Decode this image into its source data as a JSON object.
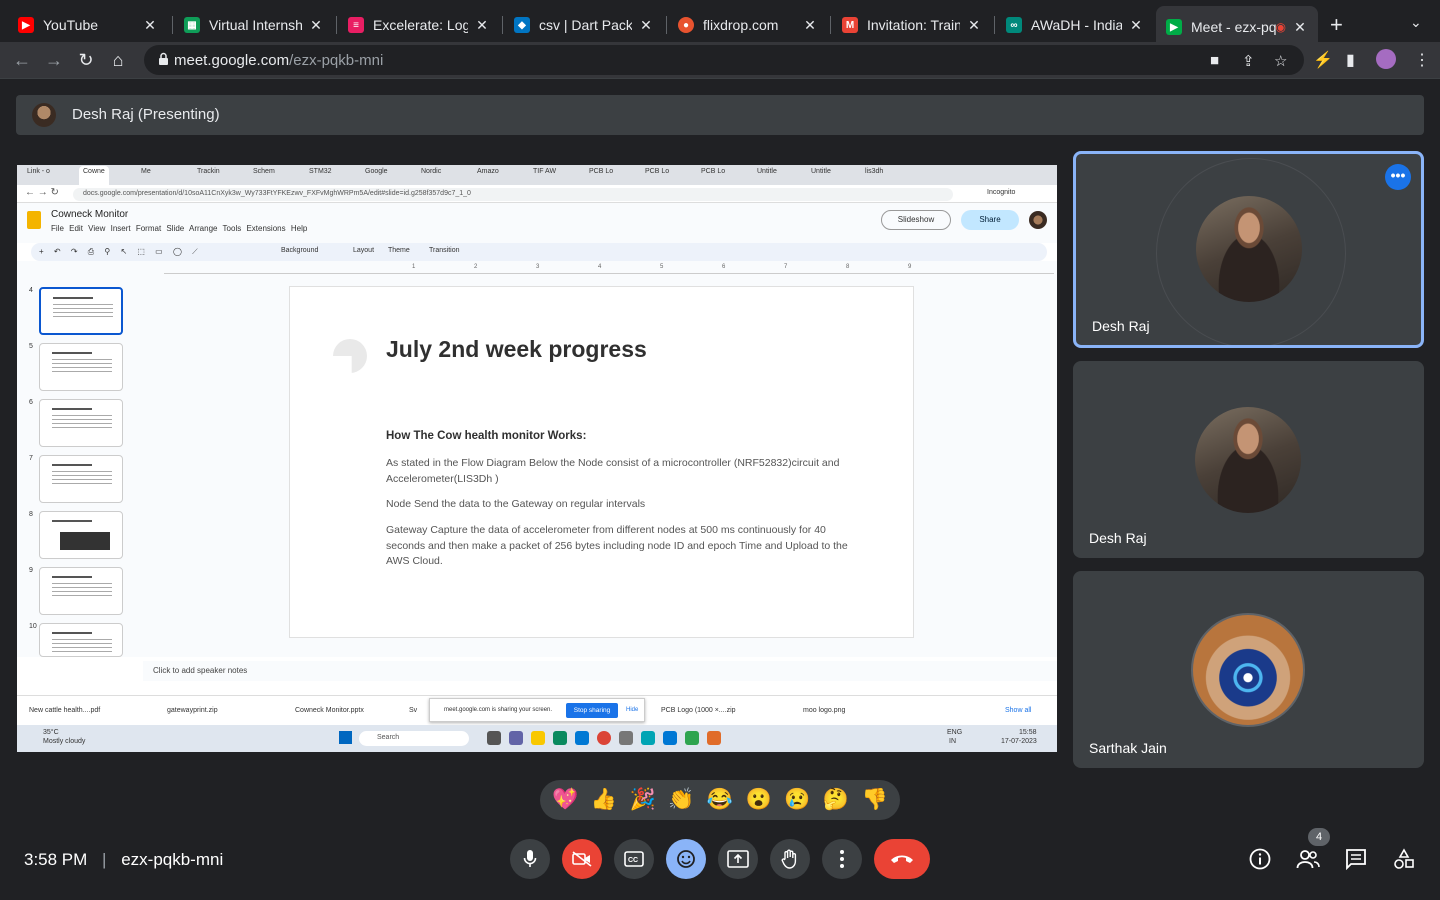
{
  "browser": {
    "tabs": [
      {
        "title": "YouTube",
        "icon": "youtube-icon",
        "color": "#ff0000"
      },
      {
        "title": "Virtual Internship",
        "icon": "google-sheets-icon",
        "color": "#0f9d58"
      },
      {
        "title": "Excelerate: Log in",
        "icon": "excelerate-icon",
        "color": "#e91e63"
      },
      {
        "title": "csv | Dart Package",
        "icon": "dart-icon",
        "color": "#0175c2"
      },
      {
        "title": "flixdrop.com",
        "icon": "flixdrop-icon",
        "color": "#e8532f"
      },
      {
        "title": "Invitation: Training",
        "icon": "gmail-icon",
        "color": "#ea4335"
      },
      {
        "title": "AWaDH - Indian In",
        "icon": "awadh-icon",
        "color": "#00897b"
      },
      {
        "title": "Meet - ezx-pq",
        "icon": "meet-icon",
        "color": "#00ac47"
      }
    ],
    "address": {
      "domain": "meet.google.com",
      "path": "/ezx-pqkb-mni"
    }
  },
  "meet": {
    "presenting_label": "Desh Raj (Presenting)",
    "meeting_code": "ezx-pqkb-mni",
    "time": "3:58 PM",
    "participant_count": "4",
    "participants": [
      {
        "name": "Desh Raj",
        "speaking": true
      },
      {
        "name": "Desh Raj",
        "speaking": false
      },
      {
        "name": "Sarthak Jain",
        "speaking": false
      }
    ],
    "reactions": [
      "💖",
      "👍",
      "🎉",
      "👏",
      "😂",
      "😮",
      "😢",
      "🤔",
      "👎"
    ]
  },
  "shared_screen": {
    "inner_tabs": [
      "Link - o",
      "Cowne",
      "Me",
      "Trackin",
      "Schem",
      "STM32",
      "Google",
      "Nordic",
      "Amazo",
      "TIF AW",
      "PCB Lo",
      "PCB Lo",
      "PCB Lo",
      "Untitle",
      "Untitle",
      "lis3dh"
    ],
    "inner_url": "docs.google.com/presentation/d/10soA11CnXyk3w_Wy733FtYFKEzwv_FXFvMghWRPm5A/edit#slide=id.g258f357d9c7_1_0",
    "incognito": "Incognito",
    "doc_title": "Cowneck Monitor",
    "doc_menu": [
      "File",
      "Edit",
      "View",
      "Insert",
      "Format",
      "Slide",
      "Arrange",
      "Tools",
      "Extensions",
      "Help"
    ],
    "slideshow": "Slideshow",
    "share": "Share",
    "toolbar": [
      "Background",
      "Layout",
      "Theme",
      "Transition"
    ],
    "thumb_numbers": [
      "4",
      "5",
      "6",
      "7",
      "8",
      "9",
      "10"
    ],
    "ruler_ticks": [
      "1",
      "2",
      "3",
      "4",
      "5",
      "6",
      "7",
      "8",
      "9"
    ],
    "slide": {
      "title": "July 2nd week progress",
      "heading": "How The Cow health monitor Works:",
      "p1": "As stated in the Flow Diagram Below the Node consist of a microcontroller (NRF52832)circuit and Accelerometer(LIS3Dh )",
      "p2": "Node Send the data to the Gateway on regular intervals",
      "p3": "Gateway Capture the data of accelerometer from different nodes at 500 ms continuously for 40 seconds and then make a packet of 256 bytes including node ID and epoch Time and Upload to the AWS Cloud."
    },
    "notes": "Click to add speaker notes",
    "downloads": [
      "New cattle health....pdf",
      "gatewayprint.zip",
      "Cowneck Monitor.pptx",
      "Sv",
      "PCB Logo (1000 ×....zip",
      "moo logo.png"
    ],
    "show_all": "Show all",
    "share_notice": "meet.google.com is sharing your screen.",
    "stop_sharing": "Stop sharing",
    "hide": "Hide",
    "weather_temp": "35°C",
    "weather_desc": "Mostly cloudy",
    "search": "Search",
    "lang": "ENG",
    "lang2": "IN",
    "clock": "15:58",
    "date": "17-07-2023"
  }
}
